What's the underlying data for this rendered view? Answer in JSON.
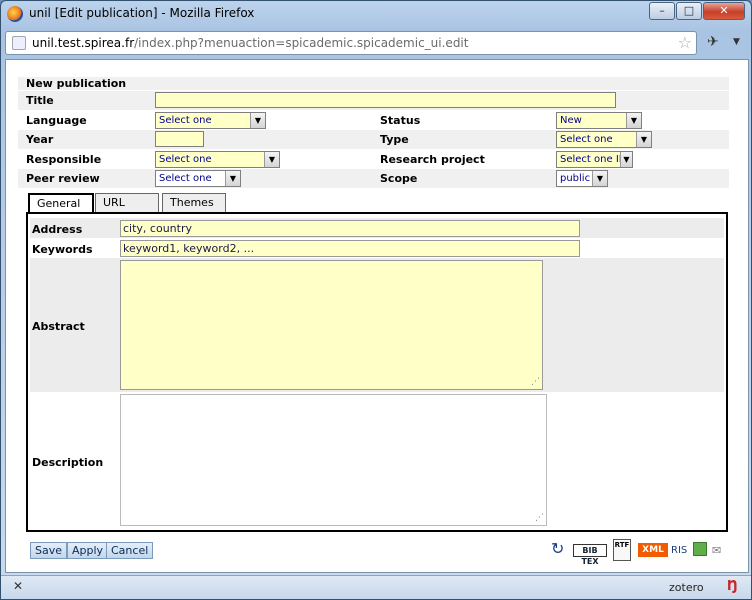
{
  "window": {
    "title": "unil [Edit publication] - Mozilla Firefox",
    "url_host": "unil.test.spirea.fr",
    "url_path": "/index.php?menuaction=spicademic.spicademic_ui.edit",
    "minimize": "–",
    "maximize": "□",
    "close": "✕"
  },
  "form": {
    "heading": "New publication",
    "title_label": "Title",
    "title_value": "",
    "language_label": "Language",
    "language_value": "Select one",
    "status_label": "Status",
    "status_value": "New",
    "year_label": "Year",
    "year_value": "",
    "type_label": "Type",
    "type_value": "Select one",
    "responsible_label": "Responsible",
    "responsible_value": "Select one",
    "project_label": "Research project",
    "project_value": "Select one IP",
    "peer_label": "Peer review",
    "peer_value": "Select one",
    "scope_label": "Scope",
    "scope_value": "public"
  },
  "tabs": [
    "General",
    "URL",
    "Themes"
  ],
  "active_tab": "General",
  "general": {
    "address_label": "Address",
    "address_value": "city, country",
    "keywords_label": "Keywords",
    "keywords_value": "keyword1, keyword2, ...",
    "abstract_label": "Abstract",
    "abstract_value": "",
    "description_label": "Description",
    "description_value": ""
  },
  "buttons": {
    "save": "Save",
    "apply": "Apply",
    "cancel": "Cancel"
  },
  "exports": {
    "bibtex": "BIB TEX",
    "rtf": "RTF",
    "xml": "XML",
    "ris": "RIS"
  },
  "statusbar": {
    "close": "✕",
    "zotero": "zotero"
  }
}
